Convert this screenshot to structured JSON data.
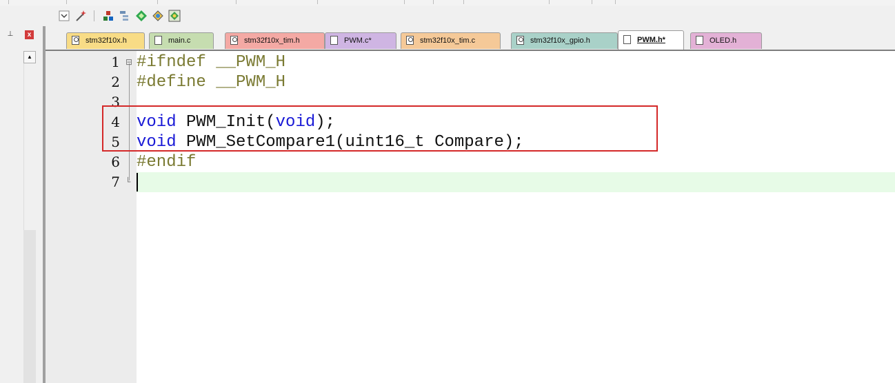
{
  "toolbar": {
    "icons": [
      "dropdown-icon",
      "magic-wand-icon",
      "components-icon",
      "tree-icon",
      "green-diamond-icon",
      "pack-installer-icon",
      "manage-icon"
    ]
  },
  "left_panel": {
    "pin_glyph": "⊥",
    "close_glyph": "x"
  },
  "tabs": [
    {
      "label": "stm32f10x.h",
      "color": "#f8dc86",
      "icon": "key-file-icon",
      "active": false
    },
    {
      "label": "main.c",
      "color": "#c6ddb0",
      "icon": "file-icon",
      "active": false
    },
    {
      "label": "stm32f10x_tim.h",
      "color": "#f4a9a4",
      "icon": "key-file-icon",
      "active": false
    },
    {
      "label": "PWM.c*",
      "color": "#cfb5e3",
      "icon": "file-icon",
      "active": false
    },
    {
      "label": "stm32f10x_tim.c",
      "color": "#f5c998",
      "icon": "key-file-icon",
      "active": false
    },
    {
      "label": "stm32f10x_gpio.h",
      "color": "#a9d1c8",
      "icon": "key-file-icon",
      "active": false
    },
    {
      "label": "PWM.h*",
      "color": "#ffffff",
      "icon": "file-icon",
      "active": true
    },
    {
      "label": "OLED.h",
      "color": "#e3b1d6",
      "icon": "file-icon",
      "active": false
    }
  ],
  "editor": {
    "lines": [
      {
        "num": "1",
        "fold": "⊟",
        "tokens": [
          {
            "t": "#ifndef __PWM_H",
            "c": "pp"
          }
        ]
      },
      {
        "num": "2",
        "fold": "",
        "tokens": [
          {
            "t": "#define __PWM_H",
            "c": "pp"
          }
        ]
      },
      {
        "num": "3",
        "fold": "",
        "tokens": []
      },
      {
        "num": "4",
        "fold": "",
        "tokens": [
          {
            "t": "void",
            "c": "kw"
          },
          {
            "t": " PWM_Init(",
            "c": "plain"
          },
          {
            "t": "void",
            "c": "kw"
          },
          {
            "t": ");",
            "c": "plain"
          }
        ]
      },
      {
        "num": "5",
        "fold": "",
        "tokens": [
          {
            "t": "void",
            "c": "kw"
          },
          {
            "t": " PWM_SetCompare1(uint16_t Compare);",
            "c": "plain"
          }
        ]
      },
      {
        "num": "6",
        "fold": "",
        "tokens": [
          {
            "t": "#endif",
            "c": "pp"
          }
        ]
      },
      {
        "num": "7",
        "fold": "└",
        "tokens": []
      }
    ],
    "current_line": 7,
    "highlight_color": "#d42828"
  }
}
